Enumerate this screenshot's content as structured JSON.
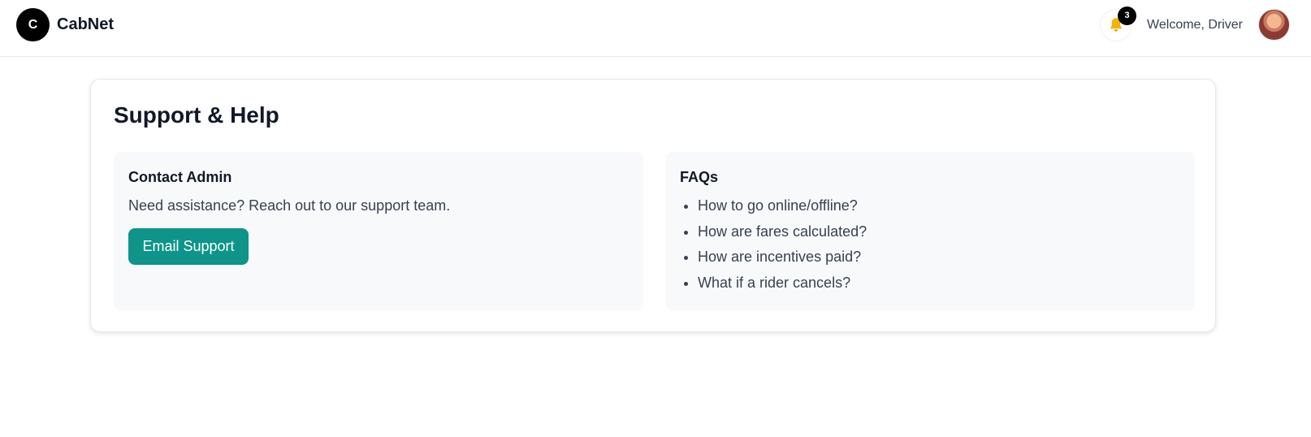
{
  "header": {
    "logo_letter": "C",
    "brand_name": "CabNet",
    "notification_count": "3",
    "welcome_text": "Welcome, Driver"
  },
  "main": {
    "title": "Support & Help",
    "contact": {
      "heading": "Contact Admin",
      "text": "Need assistance? Reach out to our support team.",
      "button_label": "Email Support"
    },
    "faqs": {
      "heading": "FAQs",
      "items": [
        "How to go online/offline?",
        "How are fares calculated?",
        "How are incentives paid?",
        "What if a rider cancels?"
      ]
    }
  },
  "colors": {
    "accent": "#0e9488",
    "panel_bg": "#f8f9fb",
    "bell": "#f5b301"
  },
  "icons": {
    "notification": "bell-icon",
    "profile": "avatar"
  }
}
